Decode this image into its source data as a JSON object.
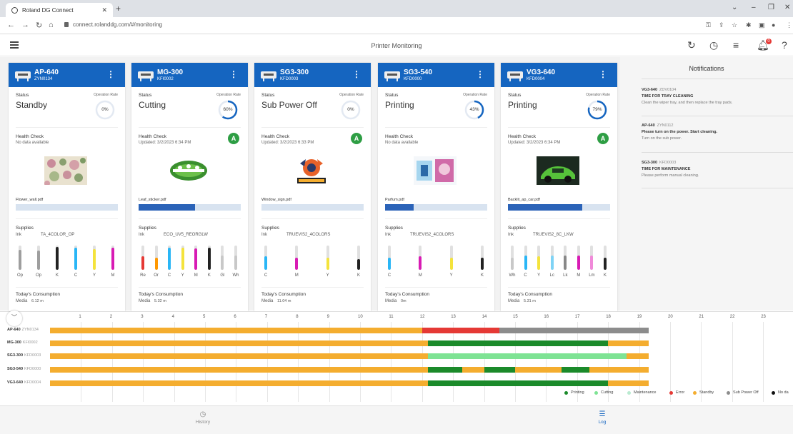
{
  "browser": {
    "tab_title": "Roland DG Connect",
    "url": "connect.rolanddg.com/#/monitoring"
  },
  "app": {
    "title": "Printer Monitoring",
    "notification_count": "0"
  },
  "cards": [
    {
      "name": "AP-640",
      "serial": "ZYN0134",
      "status_label": "Status",
      "status": "Standby",
      "oprate_label": "Operation Rate",
      "rate": "0%",
      "rate_value": 0,
      "health_label": "Health Check",
      "health_sub": "No data available",
      "grade": "",
      "thumb": "floral",
      "job": "Flower_wall.pdf",
      "job_progress": 0,
      "supplies_label": "Supplies",
      "ink_label": "Ink",
      "ink_set": "TA_4COLOR_OP",
      "inks": [
        {
          "code": "Op",
          "color": "#9e9e9e",
          "level": 0.82
        },
        {
          "code": "Op",
          "color": "#9e9e9e",
          "level": 0.78
        },
        {
          "code": "K",
          "color": "#222222",
          "level": 0.95
        },
        {
          "code": "C",
          "color": "#29b6f6",
          "level": 0.9
        },
        {
          "code": "Y",
          "color": "#f4e33c",
          "level": 0.85
        },
        {
          "code": "M",
          "color": "#d81bb4",
          "level": 0.9
        }
      ],
      "consumption_label": "Today's Consumption",
      "media_label": "Media",
      "media": "6.12 m"
    },
    {
      "name": "MG-300",
      "serial": "KFI0002",
      "status_label": "Status",
      "status": "Cutting",
      "oprate_label": "Operation Rate",
      "rate": "60%",
      "rate_value": 0.6,
      "health_label": "Health Check",
      "health_sub": "Updated: 3/2/2023 6:34 PM",
      "grade": "A",
      "thumb": "leaf",
      "job": "Leaf_sticker.pdf",
      "job_progress": 0.55,
      "supplies_label": "Supplies",
      "ink_label": "Ink",
      "ink_set": "ECO_UV5_REORGLW",
      "inks": [
        {
          "code": "Re",
          "color": "#e53935",
          "level": 0.55
        },
        {
          "code": "Or",
          "color": "#ff9800",
          "level": 0.5
        },
        {
          "code": "C",
          "color": "#29b6f6",
          "level": 0.9
        },
        {
          "code": "Y",
          "color": "#f4e33c",
          "level": 0.9
        },
        {
          "code": "M",
          "color": "#d81bb4",
          "level": 0.88
        },
        {
          "code": "K",
          "color": "#222222",
          "level": 0.9
        },
        {
          "code": "Gl",
          "color": "#c8c8c8",
          "level": 0.6
        },
        {
          "code": "Wh",
          "color": "#c8c8c8",
          "level": 0.6
        }
      ],
      "consumption_label": "Today's Consumption",
      "media_label": "Media",
      "media": "5.32 m"
    },
    {
      "name": "SG3-300",
      "serial": "KFD0003",
      "status_label": "Status",
      "status": "Sub Power Off",
      "oprate_label": "Operation Rate",
      "rate": "0%",
      "rate_value": 0,
      "health_label": "Health Check",
      "health_sub": "Updated: 3/2/2023 6:33 PM",
      "grade": "A",
      "thumb": "poster",
      "job": "Window_sign.pdf",
      "job_progress": 0,
      "supplies_label": "Supplies",
      "ink_label": "Ink",
      "ink_set": "TRUEVIS2_4COLORS",
      "inks": [
        {
          "code": "C",
          "color": "#29b6f6",
          "level": 0.55
        },
        {
          "code": "M",
          "color": "#d81bb4",
          "level": 0.5
        },
        {
          "code": "Y",
          "color": "#f4e33c",
          "level": 0.5
        },
        {
          "code": "K",
          "color": "#222222",
          "level": 0.45
        }
      ],
      "consumption_label": "Today's Consumption",
      "media_label": "Media",
      "media": "11.04 m"
    },
    {
      "name": "SG3-540",
      "serial": "KFD0000",
      "status_label": "Status",
      "status": "Printing",
      "oprate_label": "Operation Rate",
      "rate": "43%",
      "rate_value": 0.43,
      "health_label": "Health Check",
      "health_sub": "No data available",
      "grade": "",
      "thumb": "perfume",
      "job": "Parfum.pdf",
      "job_progress": 0.28,
      "supplies_label": "Supplies",
      "ink_label": "Ink",
      "ink_set": "TRUEVIS2_4COLORS",
      "inks": [
        {
          "code": "C",
          "color": "#29b6f6",
          "level": 0.5
        },
        {
          "code": "M",
          "color": "#d81bb4",
          "level": 0.55
        },
        {
          "code": "Y",
          "color": "#f4e33c",
          "level": 0.5
        },
        {
          "code": "K",
          "color": "#222222",
          "level": 0.5
        }
      ],
      "consumption_label": "Today's Consumption",
      "media_label": "Media",
      "media": "0m"
    },
    {
      "name": "VG3-640",
      "serial": "KFD0004",
      "status_label": "Status",
      "status": "Printing",
      "oprate_label": "Operation Rate",
      "rate": "79%",
      "rate_value": 0.79,
      "health_label": "Health Check",
      "health_sub": "Updated: 3/2/2023 6:34 PM",
      "grade": "A",
      "thumb": "car",
      "job": "Backlit_ap_car.pdf",
      "job_progress": 0.73,
      "supplies_label": "Supplies",
      "ink_label": "Ink",
      "ink_set": "TRUEVIS2_8C_LKW",
      "inks": [
        {
          "code": "Wh",
          "color": "#c8c8c8",
          "level": 0.5
        },
        {
          "code": "C",
          "color": "#29b6f6",
          "level": 0.6
        },
        {
          "code": "Y",
          "color": "#f4e33c",
          "level": 0.55
        },
        {
          "code": "Lc",
          "color": "#7fd3f5",
          "level": 0.6
        },
        {
          "code": "Lk",
          "color": "#888888",
          "level": 0.6
        },
        {
          "code": "M",
          "color": "#d81bb4",
          "level": 0.6
        },
        {
          "code": "Lm",
          "color": "#f08ad9",
          "level": 0.6
        },
        {
          "code": "K",
          "color": "#222222",
          "level": 0.5
        }
      ],
      "consumption_label": "Today's Consumption",
      "media_label": "Media",
      "media": "5.31 m"
    }
  ],
  "notifications": {
    "title": "Notifications",
    "items": [
      {
        "device": "VG3-640",
        "serial": "ZDV0104",
        "message": "TIME FOR TRAY CLEANING",
        "detail": "Clean the wiper tray, and then replace the tray pads."
      },
      {
        "device": "AP-640",
        "serial": "ZYN0112",
        "message": "Please turn on the power. Start cleaning.",
        "detail": "Turn on the sub power."
      },
      {
        "device": "SG3-300",
        "serial": "KFD0003",
        "message": "TIME FOR MAINTENANCE",
        "detail": "Please perform manual cleaning."
      }
    ]
  },
  "timeline": {
    "hours": [
      "1",
      "2",
      "3",
      "4",
      "5",
      "6",
      "7",
      "8",
      "9",
      "10",
      "11",
      "12",
      "13",
      "14",
      "15",
      "16",
      "17",
      "18",
      "19",
      "20",
      "21",
      "22",
      "23"
    ],
    "rows": [
      {
        "name": "AP-640",
        "serial": "ZYN0134",
        "segments": [
          {
            "from": 0,
            "to": 12,
            "state": "standby"
          },
          {
            "from": 12,
            "to": 14.5,
            "state": "error"
          },
          {
            "from": 14.5,
            "to": 19.3,
            "state": "sub_power_off"
          }
        ]
      },
      {
        "name": "MG-300",
        "serial": "KFI0002",
        "segments": [
          {
            "from": 0,
            "to": 12.2,
            "state": "standby"
          },
          {
            "from": 12.2,
            "to": 18.0,
            "state": "printing"
          },
          {
            "from": 18.0,
            "to": 19.3,
            "state": "standby"
          }
        ]
      },
      {
        "name": "SG3-300",
        "serial": "KFD0003",
        "segments": [
          {
            "from": 0,
            "to": 12.2,
            "state": "standby"
          },
          {
            "from": 12.2,
            "to": 18.6,
            "state": "cutting"
          },
          {
            "from": 18.6,
            "to": 19.3,
            "state": "standby"
          }
        ]
      },
      {
        "name": "SG3-540",
        "serial": "KFD0000",
        "segments": [
          {
            "from": 0,
            "to": 12.2,
            "state": "standby"
          },
          {
            "from": 12.2,
            "to": 13.3,
            "state": "printing"
          },
          {
            "from": 13.3,
            "to": 14.0,
            "state": "standby"
          },
          {
            "from": 14.0,
            "to": 15.0,
            "state": "printing"
          },
          {
            "from": 15.0,
            "to": 16.5,
            "state": "standby"
          },
          {
            "from": 16.5,
            "to": 17.4,
            "state": "printing"
          },
          {
            "from": 17.4,
            "to": 19.3,
            "state": "standby"
          }
        ]
      },
      {
        "name": "VG3-640",
        "serial": "KFD0004",
        "segments": [
          {
            "from": 0,
            "to": 12.2,
            "state": "standby"
          },
          {
            "from": 12.2,
            "to": 18.0,
            "state": "printing"
          },
          {
            "from": 18.0,
            "to": 19.3,
            "state": "standby"
          }
        ]
      }
    ],
    "legend": [
      {
        "state": "printing",
        "label": "Printing",
        "color": "#1b8a2a"
      },
      {
        "state": "cutting",
        "label": "Cutting",
        "color": "#7ee394"
      },
      {
        "state": "maintenance",
        "label": "Maintenance",
        "color": "#b9ead0"
      },
      {
        "state": "error",
        "label": "Error",
        "color": "#e53935"
      },
      {
        "state": "standby",
        "label": "Standby",
        "color": "#f4ad2f"
      },
      {
        "state": "sub_power_off",
        "label": "Sub Power Off",
        "color": "#8c8c8c"
      },
      {
        "state": "no_data",
        "label": "No da",
        "color": "#111111"
      }
    ]
  },
  "bottomnav": {
    "history": "History",
    "log": "Log"
  },
  "colors": {
    "brand": "#1565c0",
    "ring": "#1565c0",
    "grade": "#2e9e44"
  }
}
